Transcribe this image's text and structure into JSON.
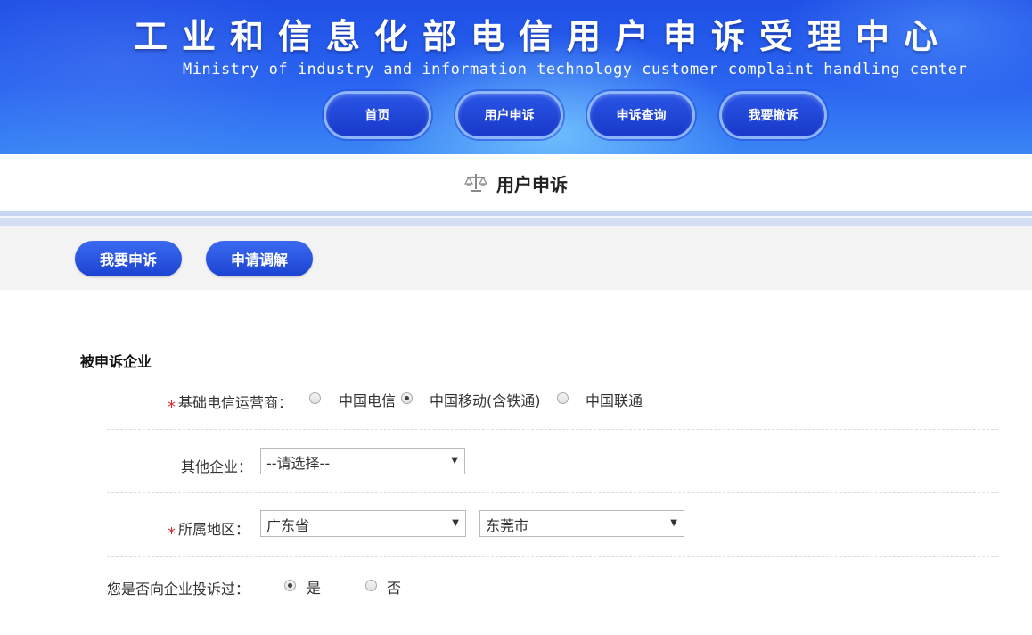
{
  "header": {
    "title": "工业和信息化部电信用户申诉受理中心",
    "subtitle": "Ministry of industry and information technology customer complaint handling center",
    "nav": [
      {
        "label": "首页"
      },
      {
        "label": "用户申诉"
      },
      {
        "label": "申诉查询"
      },
      {
        "label": "我要撤诉"
      }
    ]
  },
  "page": {
    "title": "用户申诉",
    "icon": "scale-icon"
  },
  "actions": {
    "complain_label": "我要申诉",
    "mediate_label": "申请调解"
  },
  "form": {
    "section_title": "被申诉企业",
    "required_mark": "*",
    "operator": {
      "label": "基础电信运营商：",
      "options": [
        "中国电信",
        "中国移动(含铁通)",
        "中国联通"
      ],
      "selected_index": 1
    },
    "other_company": {
      "label": "其他企业：",
      "value": "--请选择--"
    },
    "region": {
      "label": "所属地区：",
      "province": "广东省",
      "city": "东莞市"
    },
    "complained_before": {
      "label": "您是否向企业投诉过：",
      "options": [
        "是",
        "否"
      ],
      "selected_index": 0
    }
  },
  "colors": {
    "banner_blue": "#2a64f0",
    "button_blue": "#1c43d2",
    "required_red": "#d62828"
  }
}
